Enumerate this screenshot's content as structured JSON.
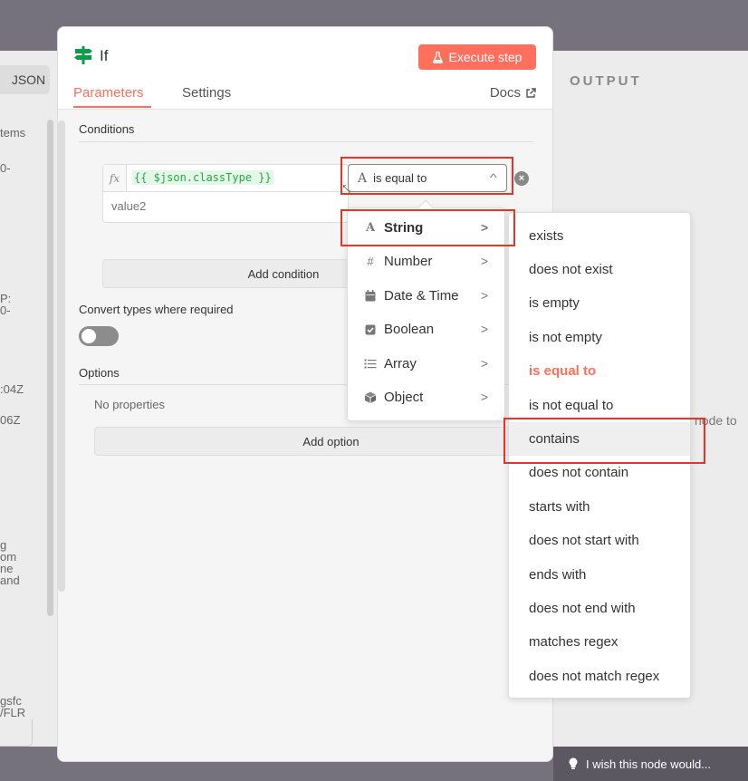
{
  "left_panel": {
    "json_tab": "JSON",
    "fragments": [
      "tems",
      "0-",
      "P:",
      "0-",
      ":04Z",
      "06Z",
      "g",
      "om",
      "ne",
      "and",
      "gsfc",
      "/FLR"
    ]
  },
  "output": {
    "title": "OUTPUT",
    "hint": "node to"
  },
  "feedback": {
    "text": "I wish this node would..."
  },
  "node": {
    "title": "If",
    "execute_label": "Execute step",
    "tabs": {
      "parameters": "Parameters",
      "settings": "Settings"
    },
    "docs": "Docs",
    "conditions_label": "Conditions",
    "fx_label": "fx",
    "value1_expression": "{{ $json.classType }}",
    "value2_placeholder": "value2",
    "operator_value": "is equal to",
    "add_condition": "Add condition",
    "convert_label": "Convert types where required",
    "convert_enabled": false,
    "options_label": "Options",
    "no_properties": "No properties",
    "add_option": "Add option"
  },
  "type_menu": {
    "items": [
      {
        "label": "String",
        "icon": "text-type-icon"
      },
      {
        "label": "Number",
        "icon": "hash-icon"
      },
      {
        "label": "Date & Time",
        "icon": "calendar-icon"
      },
      {
        "label": "Boolean",
        "icon": "checkbox-icon"
      },
      {
        "label": "Array",
        "icon": "list-icon"
      },
      {
        "label": "Object",
        "icon": "cube-icon"
      }
    ]
  },
  "operators_menu": {
    "items": [
      "exists",
      "does not exist",
      "is empty",
      "is not empty",
      "is equal to",
      "is not equal to",
      "contains",
      "does not contain",
      "starts with",
      "does not start with",
      "ends with",
      "does not end with",
      "matches regex",
      "does not match regex"
    ],
    "selected": "is equal to",
    "hovered": "contains"
  },
  "colors": {
    "accent": "#ff6f5c",
    "highlight": "#ea3323",
    "expression_green": "#27a844"
  }
}
